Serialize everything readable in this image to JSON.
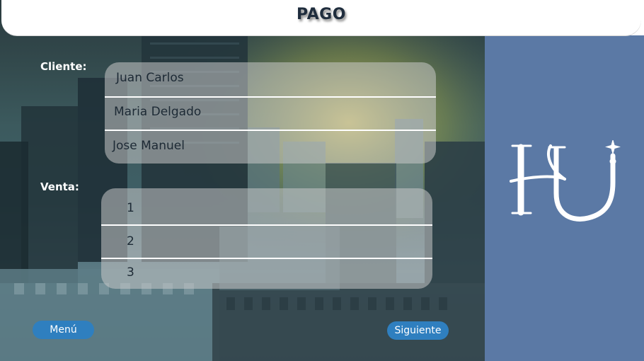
{
  "header": {
    "title": "PAGO"
  },
  "client_section": {
    "label": "Cliente:",
    "items": [
      "Juan Carlos",
      "Maria Delgado",
      "Jose Manuel"
    ]
  },
  "sale_section": {
    "label": "Venta:",
    "items": [
      "1",
      "2",
      "3"
    ]
  },
  "buttons": {
    "menu": "Menú",
    "next": "Siguiente"
  },
  "logo": {
    "text": "HU"
  },
  "colors": {
    "sidebar": "#5b79a5",
    "button": "#2f7fbf",
    "title": "#1f2d3d"
  }
}
